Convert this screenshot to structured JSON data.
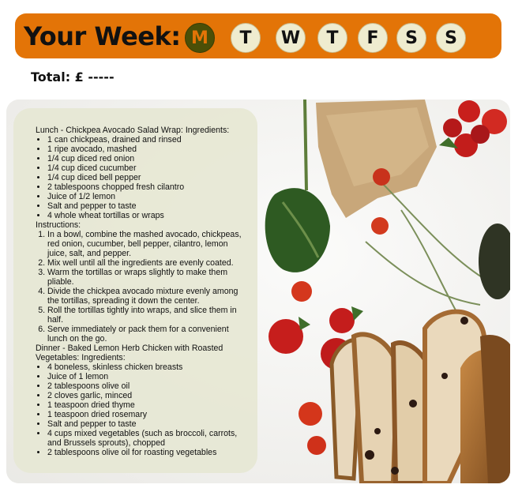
{
  "header": {
    "title": "Your Week:",
    "days": [
      "M",
      "T",
      "W",
      "T",
      "F",
      "S",
      "S"
    ],
    "active_day": "M"
  },
  "total": "Total: £ -----",
  "colors": {
    "header_bg": "#e37407",
    "day_bg": "#efeccf",
    "day_active_bg": "#4b4f07",
    "card_bg": "#e6e7d4"
  },
  "recipes": {
    "lunch": {
      "title": "Lunch - Chickpea Avocado Salad Wrap: Ingredients:",
      "ingredients": [
        "1 can chickpeas, drained and rinsed",
        "1 ripe avocado, mashed",
        "1/4 cup diced red onion",
        "1/4 cup diced cucumber",
        "1/4 cup diced bell pepper",
        "2 tablespoons chopped fresh cilantro",
        "Juice of 1/2 lemon",
        "Salt and pepper to taste",
        "4 whole wheat tortillas or wraps"
      ],
      "instructions_label": "Instructions:",
      "instructions": [
        "In a bowl, combine the mashed avocado, chickpeas, red onion, cucumber, bell pepper, cilantro, lemon juice, salt, and pepper.",
        "Mix well until all the ingredients are evenly coated.",
        "Warm the tortillas or wraps slightly to make them pliable.",
        "Divide the chickpea avocado mixture evenly among the tortillas, spreading it down the center.",
        "Roll the tortillas tightly into wraps, and slice them in half.",
        "Serve immediately or pack them for a convenient lunch on the go."
      ]
    },
    "dinner": {
      "title": "Dinner - Baked Lemon Herb Chicken with Roasted Vegetables: Ingredients:",
      "ingredients": [
        "4 boneless, skinless chicken breasts",
        "Juice of 1 lemon",
        "2 tablespoons olive oil",
        "2 cloves garlic, minced",
        "1 teaspoon dried thyme",
        "1 teaspoon dried rosemary",
        "Salt and pepper to taste",
        "4 cups mixed vegetables (such as broccoli, carrots, and Brussels sprouts), chopped",
        "2 tablespoons olive oil for roasting vegetables"
      ]
    }
  }
}
